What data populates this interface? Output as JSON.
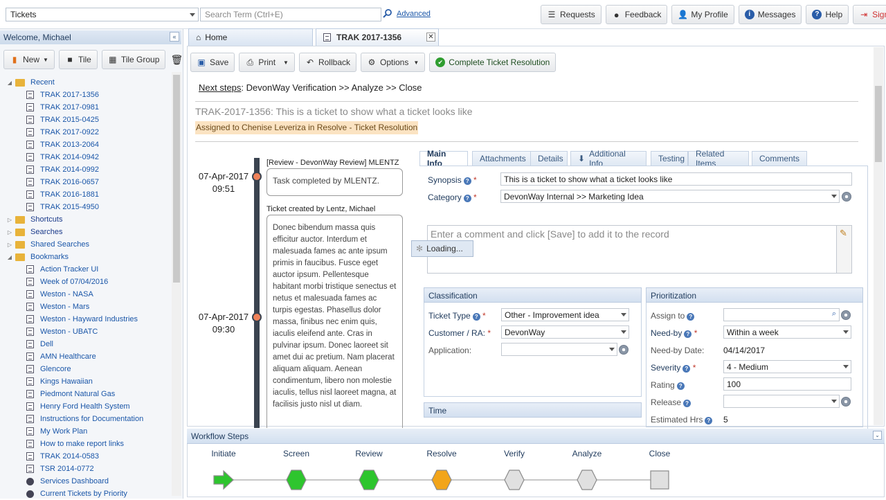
{
  "topbar": {
    "module_select": "Tickets",
    "search_placeholder": "Search Term (Ctrl+E)",
    "advanced_link": "Advanced",
    "buttons": [
      {
        "label": "Requests",
        "icon": "list-icon"
      },
      {
        "label": "Feedback",
        "icon": "lightbulb-icon"
      },
      {
        "label": "My Profile",
        "icon": "user-icon"
      },
      {
        "label": "Messages",
        "icon": "info-icon"
      },
      {
        "label": "Help",
        "icon": "help-icon"
      },
      {
        "label": "Sign Off",
        "icon": "sign-off-icon"
      }
    ]
  },
  "sidebar": {
    "welcome": "Welcome, Michael",
    "toolbar": {
      "new_label": "New",
      "tile_label": "Tile",
      "tile_group_label": "Tile Group"
    },
    "recent_label": "Recent",
    "recent_items": [
      "TRAK 2017-1356",
      "TRAK 2017-0981",
      "TRAK 2015-0425",
      "TRAK 2017-0922",
      "TRAK 2013-2064",
      "TRAK 2014-0942",
      "TRAK 2014-0992",
      "TRAK 2016-0657",
      "TRAK 2016-1881",
      "TRAK 2015-4950"
    ],
    "shortcuts_label": "Shortcuts",
    "searches_label": "Searches",
    "shared_searches_label": "Shared Searches",
    "bookmarks_label": "Bookmarks",
    "bookmark_items": [
      "Action Tracker UI",
      "Week of 07/04/2016",
      "Weston - NASA",
      "Weston - Mars",
      "Weston - Hayward Industries",
      "Weston - UBATC",
      "Dell",
      "AMN Healthcare",
      "Glencore",
      "Kings Hawaiian",
      "Piedmont Natural Gas",
      "Henry Ford Health System",
      "Instructions for Documentation",
      "My Work Plan",
      "How to make report links",
      "TRAK 2014-0583",
      "TSR 2014-0772",
      "Services Dashboard",
      "Current Tickets by Priority"
    ]
  },
  "tabs": {
    "home": "Home",
    "ticket": "TRAK 2017-1356"
  },
  "toolbar": {
    "save": "Save",
    "print": "Print",
    "rollback": "Rollback",
    "options": "Options",
    "complete": "Complete Ticket Resolution"
  },
  "ticket": {
    "next_steps_label": "Next steps",
    "next_steps_value": ": DevonWay Verification >> Analyze >> Close",
    "title": "TRAK-2017-1356: This is a ticket to show what a ticket looks like",
    "assigned": "Assigned to Chenise Leveriza in Resolve - Ticket Resolution"
  },
  "timeline": [
    {
      "date": "07-Apr-2017",
      "time": "09:51",
      "heading": "[Review - DevonWay Review] MLENTZ",
      "body": "Task completed by MLENTZ."
    },
    {
      "date": "07-Apr-2017",
      "time": "09:30",
      "heading": "Ticket created by Lentz, Michael",
      "body": "Donec bibendum massa quis efficitur auctor. Interdum et malesuada fames ac ante ipsum primis in faucibus. Fusce eget auctor ipsum. Pellentesque habitant morbi tristique senectus et netus et malesuada fames ac turpis egestas. Phasellus dolor massa, finibus nec enim quis, iaculis eleifend ante. Cras in pulvinar ipsum. Donec laoreet sit amet dui ac pretium. Nam placerat aliquam aliquam. Aenean condimentum, libero non molestie iaculis, tellus nisl laoreet magna, at facilisis justo nisl ut diam."
    }
  ],
  "detail_tabs": [
    "Main Info",
    "Attachments",
    "Details",
    "Additional Info",
    "Testing",
    "Related Items",
    "Comments"
  ],
  "main_info": {
    "synopsis_label": "Synopsis",
    "synopsis_value": "This is a ticket to show what a ticket looks like",
    "category_label": "Category",
    "category_value": "DevonWay Internal >> Marketing Idea",
    "comment_placeholder": "Enter a comment and click [Save] to add it to the record",
    "loading": "Loading..."
  },
  "classification": {
    "title": "Classification",
    "ticket_type_label": "Ticket Type",
    "ticket_type_value": "Other - Improvement idea",
    "customer_label": "Customer / RA:",
    "customer_value": "DevonWay",
    "application_label": "Application:"
  },
  "time_panel": {
    "title": "Time"
  },
  "prioritization": {
    "title": "Prioritization",
    "assign_label": "Assign to",
    "need_by_label": "Need-by",
    "need_by_value": "Within a week",
    "need_by_date_label": "Need-by Date:",
    "need_by_date_value": "04/14/2017",
    "severity_label": "Severity",
    "severity_value": "4 - Medium",
    "rating_label": "Rating",
    "rating_value": "100",
    "release_label": "Release",
    "est_hrs_label": "Estimated Hrs",
    "est_hrs_value": "5"
  },
  "workflow": {
    "title": "Workflow Steps",
    "steps": [
      {
        "label": "Initiate",
        "state": "start",
        "color": "#2ec52e"
      },
      {
        "label": "Screen",
        "state": "done",
        "color": "#2ec52e"
      },
      {
        "label": "Review",
        "state": "done",
        "color": "#2ec52e"
      },
      {
        "label": "Resolve",
        "state": "current",
        "color": "#f2a51a"
      },
      {
        "label": "Verify",
        "state": "pending",
        "color": "#e0e0e0"
      },
      {
        "label": "Analyze",
        "state": "pending",
        "color": "#e0e0e0"
      },
      {
        "label": "Close",
        "state": "end",
        "color": "#e0e0e0"
      }
    ]
  }
}
